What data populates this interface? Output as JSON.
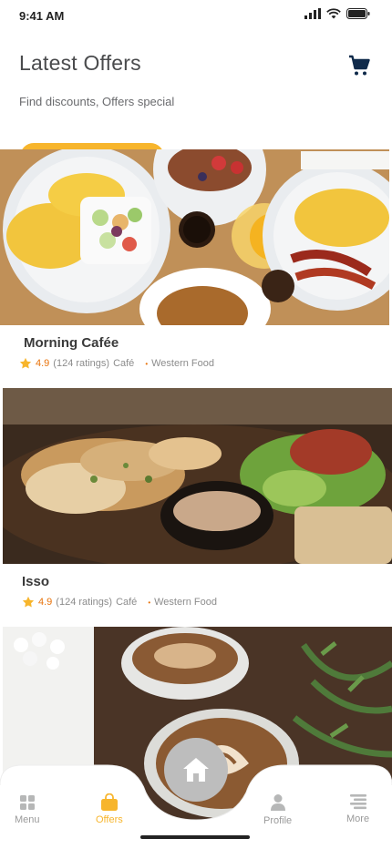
{
  "status": {
    "time": "9:41 AM"
  },
  "header": {
    "title": "Latest Offers",
    "subtitle": "Find discounts, Offers special"
  },
  "offers": [
    {
      "name": "Morning Cafée",
      "rating": "4.9",
      "ratings_count": "(124 ratings)",
      "type": "Café",
      "cuisine": "Western Food"
    },
    {
      "name": "Isso",
      "rating": "4.9",
      "ratings_count": "(124 ratings)",
      "type": "Café",
      "cuisine": "Western Food"
    }
  ],
  "tabs": {
    "menu": "Menu",
    "offers": "Offers",
    "profile": "Profile",
    "more": "More"
  },
  "colors": {
    "accent": "#f7b52c",
    "rating": "#e8730b",
    "text": "#4a4b4d"
  },
  "icons": [
    "signal-icon",
    "wifi-icon",
    "battery-icon",
    "cart-icon",
    "star-icon",
    "grid-icon",
    "bag-icon",
    "home-icon",
    "person-icon",
    "list-icon"
  ]
}
